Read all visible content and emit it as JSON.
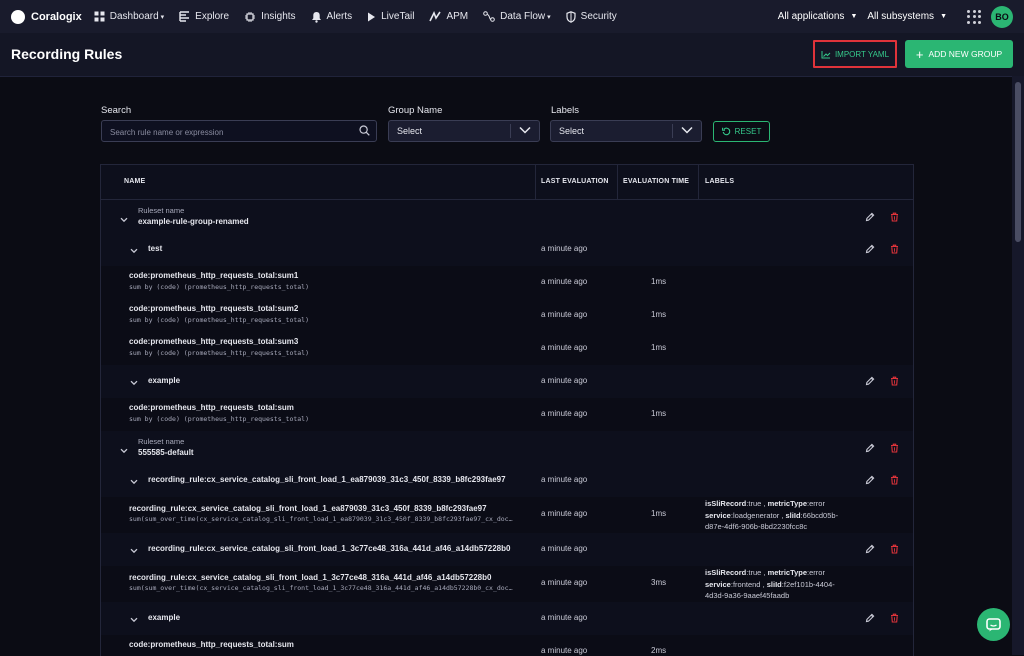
{
  "nav": {
    "brand": "Coralogix",
    "items": [
      {
        "label": "Dashboard",
        "icon": "dashboard-icon",
        "has_caret": true
      },
      {
        "label": "Explore",
        "icon": "explore-icon",
        "has_caret": false
      },
      {
        "label": "Insights",
        "icon": "insights-icon",
        "has_caret": false
      },
      {
        "label": "Alerts",
        "icon": "bell-icon",
        "has_caret": false
      },
      {
        "label": "LiveTail",
        "icon": "play-icon",
        "has_caret": false
      },
      {
        "label": "APM",
        "icon": "apm-icon",
        "has_caret": false
      },
      {
        "label": "Data Flow",
        "icon": "data-flow-icon",
        "has_caret": true
      },
      {
        "label": "Security",
        "icon": "shield-icon",
        "has_caret": false
      }
    ],
    "applications": "All applications",
    "subsystems": "All subsystems",
    "avatar": "BO"
  },
  "header": {
    "title": "Recording Rules",
    "import_label": "IMPORT YAML",
    "add_label": "ADD NEW GROUP"
  },
  "filters": {
    "search_label": "Search",
    "search_placeholder": "Search rule name or expression",
    "group_label": "Group Name",
    "group_value": "Select",
    "labels_label": "Labels",
    "labels_value": "Select",
    "reset_label": "RESET"
  },
  "table": {
    "columns": [
      "NAME",
      "LAST EVALUATION",
      "EVALUATION TIME",
      "LABELS"
    ],
    "ruleset_label": "Ruleset name",
    "rows": [
      {
        "kind": "ruleset",
        "name": "example-rule-group-renamed"
      },
      {
        "kind": "group",
        "name": "test",
        "last": "a minute ago"
      },
      {
        "kind": "rule",
        "name": "code:prometheus_http_requests_total:sum1",
        "expr": "sum by (code) (prometheus_http_requests_total)",
        "last": "a minute ago",
        "time": "1ms"
      },
      {
        "kind": "rule",
        "name": "code:prometheus_http_requests_total:sum2",
        "expr": "sum by (code) (prometheus_http_requests_total)",
        "last": "a minute ago",
        "time": "1ms"
      },
      {
        "kind": "rule",
        "name": "code:prometheus_http_requests_total:sum3",
        "expr": "sum by (code) (prometheus_http_requests_total)",
        "last": "a minute ago",
        "time": "1ms"
      },
      {
        "kind": "group",
        "name": "example",
        "last": "a minute ago"
      },
      {
        "kind": "rule",
        "name": "code:prometheus_http_requests_total:sum",
        "expr": "sum by (code) (prometheus_http_requests_total)",
        "last": "a minute ago",
        "time": "1ms"
      },
      {
        "kind": "ruleset",
        "name": "555585-default"
      },
      {
        "kind": "group",
        "name": "recording_rule:cx_service_catalog_sli_front_load_1_ea879039_31c3_450f_8339_b8fc293fae97",
        "last": "a minute ago"
      },
      {
        "kind": "rule",
        "name": "recording_rule:cx_service_catalog_sli_front_load_1_ea879039_31c3_450f_8339_b8fc293fae97",
        "expr": "sum(sum_over_time(cx_service_catalog_sli_front_load_1_ea879039_31c3_450f_8339_b8fc293fae97_cx_doc…",
        "last": "a minute ago",
        "time": "1ms",
        "labels": [
          [
            {
              "k": "isSliRecord",
              "v": "true"
            },
            {
              "k": "metricType",
              "v": "error"
            }
          ],
          [
            {
              "k": "service",
              "v": "loadgenerator"
            },
            {
              "k": "sliId",
              "v": "66bcd05b-"
            }
          ],
          [
            {
              "k": "",
              "v": "d87e-4df6-906b-8bd2230fcc8c"
            }
          ]
        ]
      },
      {
        "kind": "group",
        "name": "recording_rule:cx_service_catalog_sli_front_load_1_3c77ce48_316a_441d_af46_a14db57228b0",
        "last": "a minute ago"
      },
      {
        "kind": "rule",
        "name": "recording_rule:cx_service_catalog_sli_front_load_1_3c77ce48_316a_441d_af46_a14db57228b0",
        "expr": "sum(sum_over_time(cx_service_catalog_sli_front_load_1_3c77ce48_316a_441d_af46_a14db57228b0_cx_doc…",
        "last": "a minute ago",
        "time": "3ms",
        "labels": [
          [
            {
              "k": "isSliRecord",
              "v": "true"
            },
            {
              "k": "metricType",
              "v": "error"
            }
          ],
          [
            {
              "k": "service",
              "v": "frontend"
            },
            {
              "k": "sliId",
              "v": "f2ef101b-4404-"
            }
          ],
          [
            {
              "k": "",
              "v": "4d3d-9a36-9aaef45faadb"
            }
          ]
        ]
      },
      {
        "kind": "group",
        "name": "example",
        "last": "a minute ago"
      },
      {
        "kind": "rule",
        "name": "code:prometheus_http_requests_total:sum",
        "expr": "",
        "last": "a minute ago",
        "time": "2ms"
      }
    ]
  },
  "colors": {
    "accent": "#2bb673",
    "highlight": "#e0333a",
    "background": "#0b0c14",
    "nav": "#191b2c"
  }
}
